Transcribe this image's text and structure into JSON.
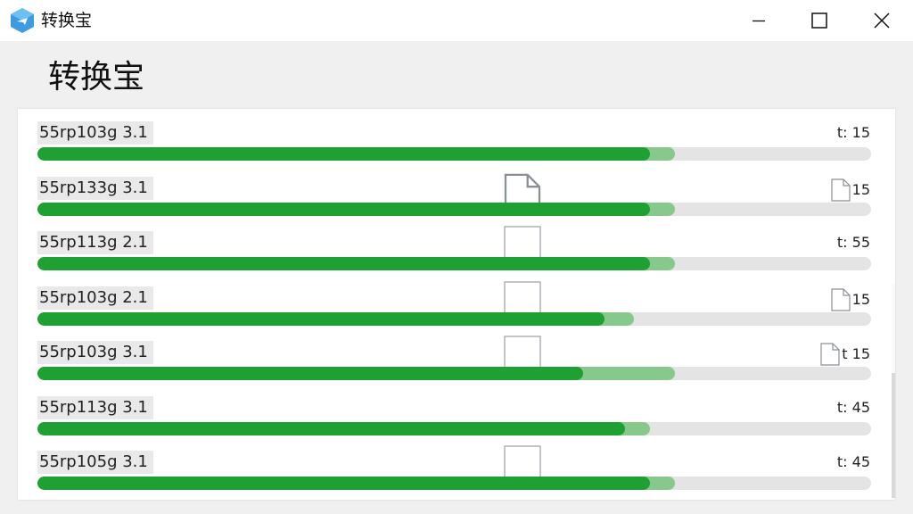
{
  "window": {
    "title": "转换宝",
    "icon": "app-logo-icon",
    "controls": [
      "minimize-icon",
      "maximize-icon",
      "close-icon"
    ]
  },
  "page": {
    "heading": "转换宝"
  },
  "colors": {
    "progress": "#1fa032",
    "buffer": "#86c98b",
    "track": "#e4e4e4"
  },
  "items": [
    {
      "name": "55rp103g 3.1",
      "time": "t: 15",
      "progress": 0.735,
      "buffer": 0.765,
      "middle_icon": "none",
      "time_icon": false
    },
    {
      "name": "55rp133g 3.1",
      "time": "15",
      "progress": 0.735,
      "buffer": 0.765,
      "middle_icon": "file",
      "time_icon": true
    },
    {
      "name": "55rp113g 2.1",
      "time": "t: 55",
      "progress": 0.735,
      "buffer": 0.765,
      "middle_icon": "box",
      "time_icon": false
    },
    {
      "name": "55rp103g 2.1",
      "time": "15",
      "progress": 0.68,
      "buffer": 0.715,
      "middle_icon": "box",
      "time_icon": true
    },
    {
      "name": "55rp103g 3.1",
      "time": "t 15",
      "progress": 0.655,
      "buffer": 0.765,
      "middle_icon": "box",
      "time_icon": true
    },
    {
      "name": "55rp113g 3.1",
      "time": "t: 45",
      "progress": 0.705,
      "buffer": 0.735,
      "middle_icon": "none",
      "time_icon": false
    },
    {
      "name": "55rp105g 3.1",
      "time": "t: 45",
      "progress": 0.735,
      "buffer": 0.765,
      "middle_icon": "box",
      "time_icon": false
    }
  ],
  "scrollbar": {
    "arrow": "↓"
  }
}
